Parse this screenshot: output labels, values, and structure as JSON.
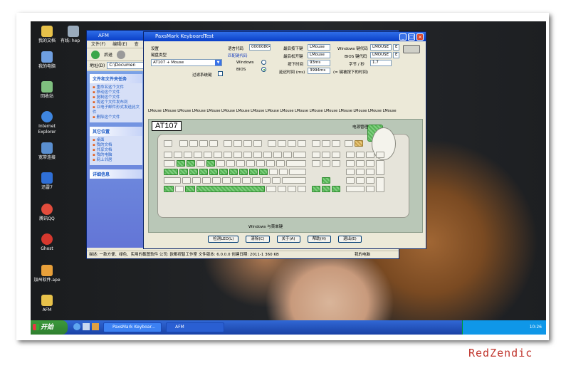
{
  "desktop": {
    "icons": [
      {
        "label": "我的文档",
        "color": "#e8c24a"
      },
      {
        "label": "我的电脑",
        "color": "#6f9fe0"
      },
      {
        "label": "回收站",
        "color": "#7fc07f"
      },
      {
        "label": "Internet Explorer",
        "color": "#3f86e0"
      },
      {
        "label": "宽带连接",
        "color": "#5a8fd0"
      },
      {
        "label": "迅雷7",
        "color": "#2f6fd6"
      },
      {
        "label": "腾讯QQ",
        "color": "#e24c3c"
      },
      {
        "label": "Ghost",
        "color": "#d6382e"
      },
      {
        "label": "加州软件.ape",
        "color": "#e8a03a"
      },
      {
        "label": "AFM",
        "color": "#e8c24a"
      }
    ],
    "partial_icon": "有线: hep"
  },
  "explorer": {
    "title": "AFM",
    "menu": [
      "文件(F)",
      "编辑(E)",
      "查"
    ],
    "back": "后退",
    "address_label": "地址(D)",
    "address_value": "C:\\Documen",
    "file_tasks_title": "文件和文件夹任务",
    "file_tasks": [
      "重命名这个文件",
      "移动这个文件",
      "复制这个文件",
      "将这个文件发布到",
      "以电子邮件形式发送此文件",
      "删除这个文件"
    ],
    "other_title": "其它位置",
    "other_places": [
      "桌面",
      "我的文档",
      "共享文档",
      "我的电脑",
      "网上邻居"
    ],
    "details_title": "详细信息",
    "status": "描述: 一款方便、绿色、实用的截图软件 公司: 欧都视智工作室 文件版本: 6.0.0.0 创建日期: 2011-1 360 KB",
    "status_right": "我的电脑"
  },
  "pax": {
    "title": "PaxsMark KeyboardTest",
    "setting_label": "设置",
    "kb_type_label": "键盘类型",
    "kb_type_value": "AT107 + Mouse",
    "filter_label": "过滤系统键",
    "lang_code_label": "语言代码",
    "lang_code_value": "00000804",
    "match_code_label": "匹配键代码",
    "windows_label": "Windows",
    "bios_label": "BIOS",
    "last_down_label": "最后按下键",
    "last_down_value": "LMouse",
    "last_up_label": "最后松开键",
    "last_up_value": "LMouse",
    "hold_time_label": "按下时间",
    "hold_time_value": "93ms",
    "delay_label": "延迟时间 (ms)",
    "delay_value": "3994ms",
    "delay_note": "(= 键被按下的时间)",
    "win_code_label": "Windows 键代码",
    "win_code_value": "LMOUSE",
    "win_code_flag": "E",
    "bios_code_label": "BIOS 键代码",
    "bios_code_value": "LMOUSE",
    "bios_code_flag": "E",
    "cps_label": "字节 / 秒",
    "cps_value": "1.7",
    "key_history": "LMouse LMouse LMouse LMouse LMouse LMouse LMouse LMouse LMouse LMouse LMouse LMouse LMouse LMouse LMouse LMouse LMouse",
    "model_label": "AT107",
    "power_label": "电源管理",
    "winkey_label": "Windows 与菜单键",
    "buttons": [
      "检测LED(L)",
      "清除(C)",
      "关于(A)",
      "帮助(H)",
      "退出(E)"
    ]
  },
  "taskbar": {
    "start": "开始",
    "tasks": [
      "PaxsMark Keyboar...",
      "AFM"
    ],
    "clock": "10:26"
  },
  "watermark": "RedZendic"
}
